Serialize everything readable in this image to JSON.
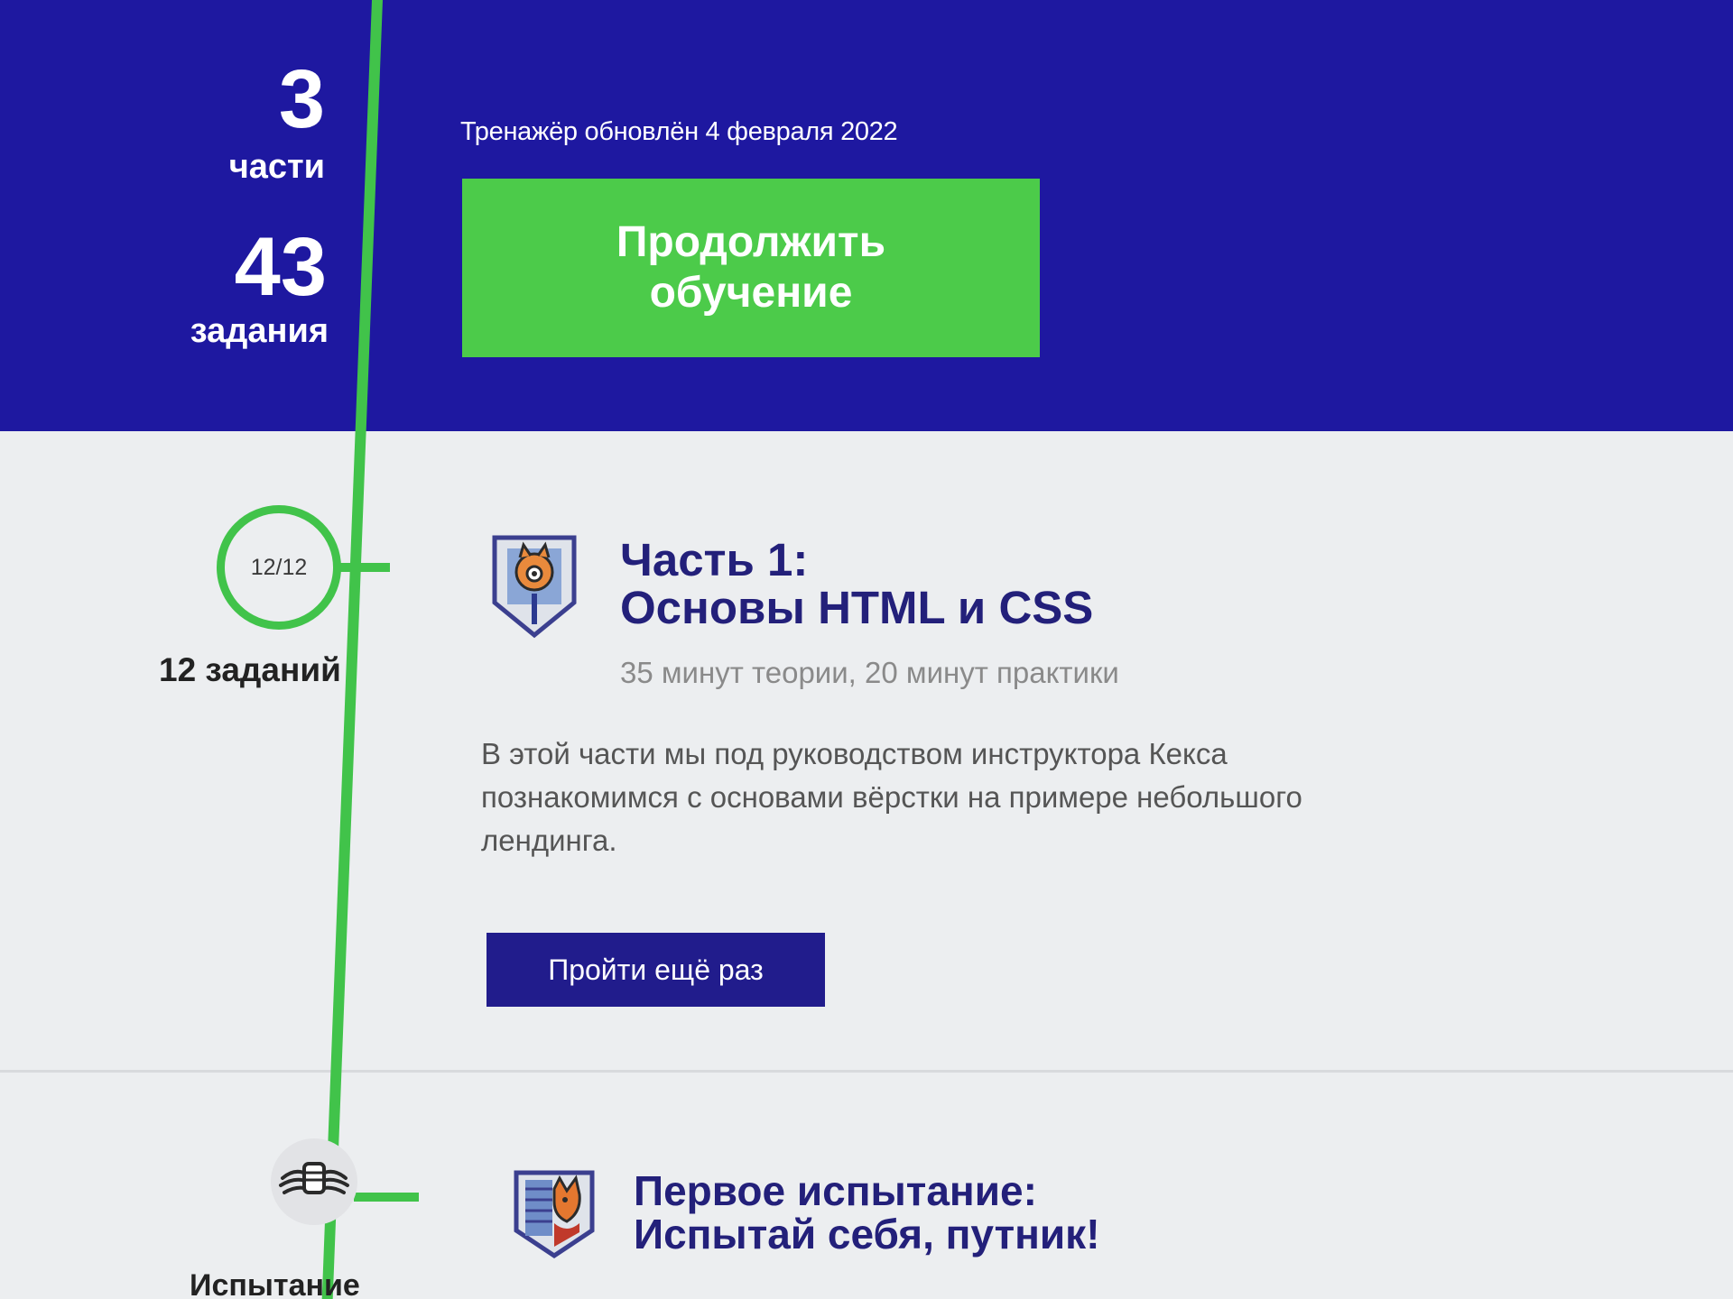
{
  "colors": {
    "hero_background": "#1e18a0",
    "accent_green": "#41c34a",
    "cta_green": "#4ccb4a",
    "title_navy": "#23207a",
    "button_navy": "#211c8c",
    "page_background": "#eceef0"
  },
  "stats": {
    "parts_value": "3",
    "parts_label": "части",
    "tasks_value": "43",
    "tasks_label": "задания"
  },
  "hero": {
    "updated_text": "Тренажёр обновлён 4 февраля 2022",
    "continue_button": "Продолжить обучение"
  },
  "parts": [
    {
      "progress": "12/12",
      "progress_fraction": 1.0,
      "tasks_label": "12 заданий",
      "badge_icon": "cat-inspector-badge-icon",
      "title_line1": "Часть 1:",
      "title_line2": "Основы HTML и CSS",
      "meta": "35 минут теории, 20 минут практики",
      "description": "В этой части мы под руководством инструктора Кекса познакомимся с основами вёрстки на примере небольшого лендинга.",
      "retry_button": "Пройти ещё раз"
    },
    {
      "emblem_icon": "fist-wings-emblem-icon",
      "badge_icon": "fox-badge-icon",
      "label": "Испытание",
      "title_line1": "Первое испытание:",
      "title_line2": "Испытай себя, путник!"
    }
  ]
}
